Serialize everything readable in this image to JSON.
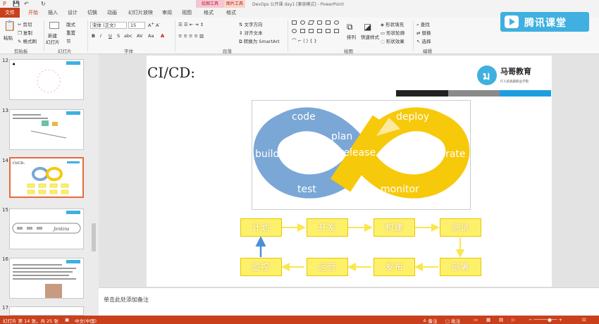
{
  "window": {
    "title": "DevOps 公开课 day1 [兼容模式] - PowerPoint",
    "context_tab_1": "绘图工具",
    "context_tab_2": "图片工具"
  },
  "tabs": [
    "文件",
    "开始",
    "插入",
    "设计",
    "切换",
    "动画",
    "幻灯片放映",
    "审阅",
    "视图",
    "格式",
    "格式"
  ],
  "ribbon": {
    "clipboard": {
      "paste": "粘贴",
      "cut": "剪切",
      "copy": "复制",
      "format_painter": "格式刷",
      "label": "剪贴板"
    },
    "slides": {
      "new_slide": "新建",
      "new_slide_2": "幻灯片",
      "layout": "版式",
      "reset": "重置",
      "section": "节",
      "label": "幻灯片"
    },
    "font": {
      "name": "宋体 (正文)",
      "size": "15",
      "bold": "B",
      "italic": "I",
      "underline": "U",
      "strike": "S",
      "shadow": "abc",
      "spacing": "AV",
      "case": "Aa",
      "label": "字体"
    },
    "paragraph": {
      "text_direction": "文字方向",
      "align_text": "对齐文本",
      "smartart": "转换为 SmartArt",
      "label": "段落"
    },
    "drawing": {
      "arrange": "排列",
      "quick_styles": "快速样式",
      "fill": "形状填充",
      "outline": "形状轮廓",
      "effects": "形状效果",
      "label": "绘图"
    },
    "editing": {
      "find": "查找",
      "replace": "替换",
      "select": "选择",
      "label": "编辑"
    }
  },
  "brand": "腾讯课堂",
  "thumbnails": [
    {
      "num": "12"
    },
    {
      "num": "13"
    },
    {
      "num": "14"
    },
    {
      "num": "15"
    },
    {
      "num": "16"
    },
    {
      "num": "17"
    }
  ],
  "slide": {
    "title": "CI/CD:",
    "logo_name": "马哥教育",
    "logo_tagline": "IT人的高薪职业学院",
    "infinity": {
      "code": "code",
      "plan": "plan",
      "build": "build",
      "test": "test",
      "release": "release",
      "deploy": "deploy",
      "operate": "operate",
      "monitor": "monitor"
    },
    "flow": {
      "plan": "计划",
      "develop": "开发",
      "build": "构建",
      "test": "测试",
      "deploy": "部署",
      "release": "发布",
      "operate": "运营",
      "monitor": "监控"
    }
  },
  "notes_placeholder": "单击此处添加备注",
  "status": {
    "slide_info": "幻灯片 第 14 张，共 25 张",
    "language": "中文(中国)",
    "notes": "备注",
    "comments": "批注"
  },
  "colors": {
    "accent": "#c9401c",
    "blue_loop": "#7aa7d6",
    "yellow_loop": "#f7c90b",
    "flow_box": "#fdf06a",
    "flow_arrow": "#fbe64d",
    "return_arrow": "#4a90d9"
  }
}
